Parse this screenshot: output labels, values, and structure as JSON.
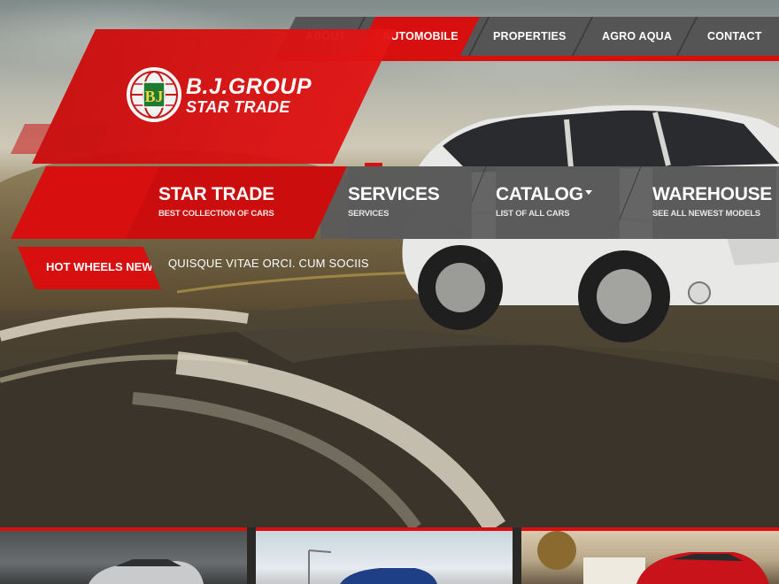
{
  "brand": {
    "logo_line1": "B.J.GROUP",
    "logo_line2": "STAR TRADE",
    "logo_monogram": "BJ",
    "accent_color": "#d7100f",
    "nav_gray": "#555555"
  },
  "topnav": {
    "items": [
      {
        "label": "ABOUT",
        "active": false
      },
      {
        "label": "AUTOMOBILE",
        "active": true
      },
      {
        "label": "PROPERTIES",
        "active": false
      },
      {
        "label": "AGRO AQUA",
        "active": false
      },
      {
        "label": "CONTACT",
        "active": false
      }
    ]
  },
  "menu": {
    "items": [
      {
        "title": "STAR TRADE",
        "subtitle": "BEST COLLECTION OF CARS"
      },
      {
        "title": "SERVICES",
        "subtitle": "SERVICES"
      },
      {
        "title": "CATALOG",
        "subtitle": "LIST OF ALL CARS",
        "dropdown": true
      },
      {
        "title": "WAREHOUSE",
        "subtitle": "SEE ALL NEWEST MODELS"
      }
    ]
  },
  "news": {
    "label": "HOT WHEELS NEWS",
    "headline": "QUISQUE VITAE ORCI. CUM SOCIIS"
  },
  "thumbnails": [
    {
      "name": "silver-sedan-photo"
    },
    {
      "name": "blue-car-photo"
    },
    {
      "name": "red-suv-photo"
    }
  ]
}
